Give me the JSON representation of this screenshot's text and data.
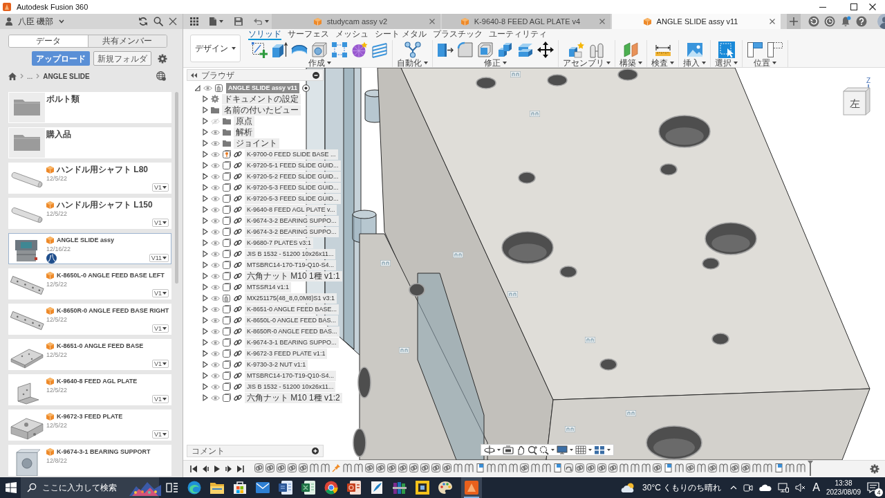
{
  "window": {
    "title": "Autodesk Fusion 360"
  },
  "data_panel": {
    "user": "八臣 磯部",
    "tabs": [
      {
        "label": "データ",
        "selected": true
      },
      {
        "label": "共有メンバー",
        "selected": false
      }
    ],
    "upload_button": "アップロード",
    "new_folder_button": "新規フォルダ",
    "breadcrumb": [
      "...",
      "ANGLE SLIDE"
    ],
    "items": [
      {
        "kind": "folder",
        "title": "ボルト類"
      },
      {
        "kind": "folder",
        "title": "購入品"
      },
      {
        "kind": "shaft",
        "title": "ハンドル用シャフト L80",
        "date": "12/5/22",
        "version": "V1",
        "selected": false
      },
      {
        "kind": "shaft",
        "title": "ハンドル用シャフト L150",
        "date": "12/5/22",
        "version": "V1",
        "selected": false
      },
      {
        "kind": "assembly",
        "title": "ANGLE SLIDE assy",
        "date": "12/16/22",
        "version": "V11",
        "selected": true,
        "editor": "八"
      },
      {
        "kind": "rail",
        "title": "K-8650L-0 ANGLE FEED BASE LEFT",
        "date": "12/5/22",
        "version": "V1",
        "selected": false
      },
      {
        "kind": "rail",
        "title": "K-8650R-0 ANGLE FEED BASE RIGHT",
        "date": "12/5/22",
        "version": "V1",
        "selected": false
      },
      {
        "kind": "plate",
        "title": "K-8651-0 ANGLE FEED BASE",
        "date": "12/5/22",
        "version": "V1",
        "selected": false
      },
      {
        "kind": "bracket",
        "title": "K-9640-8 FEED AGL PLATE",
        "date": "12/5/22",
        "version": "V1",
        "selected": false
      },
      {
        "kind": "block",
        "title": "K-9672-3 FEED PLATE",
        "date": "12/5/22",
        "version": "V1",
        "selected": false
      },
      {
        "kind": "support",
        "title": "K-9674-3-1 BEARING SUPPORT",
        "date": "12/8/22",
        "selected": false
      }
    ]
  },
  "document_tabs": [
    {
      "label": "studycam assy v2",
      "selected": false
    },
    {
      "label": "K-9640-8 FEED AGL PLATE v4",
      "selected": false
    },
    {
      "label": "ANGLE SLIDE assy v11",
      "selected": true
    }
  ],
  "toolbar": {
    "workspace": "デザイン",
    "tabs": [
      {
        "label": "ソリッド",
        "selected": true
      },
      {
        "label": "サーフェス",
        "selected": false
      },
      {
        "label": "メッシュ",
        "selected": false
      },
      {
        "label": "シート メタル",
        "selected": false
      },
      {
        "label": "プラスチック",
        "selected": false
      },
      {
        "label": "ユーティリティ",
        "selected": false
      }
    ],
    "groups": [
      {
        "label": "作成"
      },
      {
        "label": "自動化"
      },
      {
        "label": "修正"
      },
      {
        "label": "アセンブリ"
      },
      {
        "label": "構築"
      },
      {
        "label": "検査"
      },
      {
        "label": "挿入"
      },
      {
        "label": "選択"
      },
      {
        "label": "位置"
      }
    ]
  },
  "browser": {
    "title": "ブラウザ",
    "root": {
      "label": "ANGLE SLIDE assy v11",
      "expanded": true,
      "visible": true
    },
    "nodes": [
      {
        "kind": "settings",
        "label": "ドキュメントの設定",
        "expanded": false
      },
      {
        "kind": "views",
        "label": "名前の付いたビュー",
        "expanded": false
      },
      {
        "kind": "folder",
        "label": "原点",
        "expanded": false,
        "visible": false
      },
      {
        "kind": "folder",
        "label": "解析",
        "expanded": false,
        "visible": true
      },
      {
        "kind": "folder",
        "label": "ジョイント",
        "expanded": false,
        "visible": true
      },
      {
        "kind": "component",
        "label": "K-9700-0 FEED SLIDE BASE ...",
        "expanded": false,
        "visible": true,
        "grounded": true
      },
      {
        "kind": "component",
        "label": "K-9720-5-1 FEED SLIDE GUID...",
        "expanded": false,
        "visible": true,
        "grounded": false
      },
      {
        "kind": "component",
        "label": "K-9720-5-2 FEED SLIDE GUID...",
        "expanded": false,
        "visible": true,
        "grounded": false
      },
      {
        "kind": "component",
        "label": "K-9720-5-3 FEED SLIDE GUID...",
        "expanded": false,
        "visible": true,
        "grounded": false
      },
      {
        "kind": "component",
        "label": "K-9720-5-3 FEED SLIDE GUID...",
        "expanded": false,
        "visible": true,
        "grounded": false
      },
      {
        "kind": "component",
        "label": "K-9640-8 FEED AGL PLATE v...",
        "expanded": false,
        "visible": true,
        "grounded": false
      },
      {
        "kind": "component",
        "label": "K-9674-3-2 BEARING SUPPO...",
        "expanded": false,
        "visible": true,
        "grounded": false
      },
      {
        "kind": "component",
        "label": "K-9674-3-2 BEARING SUPPO...",
        "expanded": false,
        "visible": true,
        "grounded": false
      },
      {
        "kind": "component",
        "label": "K-9680-7 PLATES v3:1",
        "expanded": false,
        "visible": true,
        "grounded": false
      },
      {
        "kind": "component",
        "label": "JIS B 1532 - 51200 10x26x11...",
        "expanded": false,
        "visible": true,
        "grounded": false
      },
      {
        "kind": "component",
        "label": "MTSBRC14-170-T19-Q10-S4...",
        "expanded": false,
        "visible": true,
        "grounded": false
      },
      {
        "kind": "component",
        "label": "六角ナット M10 1種 v1:1",
        "expanded": false,
        "visible": true,
        "grounded": false
      },
      {
        "kind": "component",
        "label": "MTSSR14 v1:1",
        "expanded": false,
        "visible": true,
        "grounded": false
      },
      {
        "kind": "assembly",
        "label": "MX251175(48_8,0,0M8)S1 v3:1",
        "expanded": false,
        "visible": true,
        "grounded": false
      },
      {
        "kind": "component",
        "label": "K-8651-0 ANGLE FEED BASE...",
        "expanded": false,
        "visible": true,
        "grounded": false
      },
      {
        "kind": "component",
        "label": "K-8650L-0 ANGLE FEED BAS...",
        "expanded": false,
        "visible": true,
        "grounded": false
      },
      {
        "kind": "component",
        "label": "K-8650R-0 ANGLE FEED BAS...",
        "expanded": false,
        "visible": true,
        "grounded": false
      },
      {
        "kind": "component",
        "label": "K-9674-3-1 BEARING SUPPO...",
        "expanded": false,
        "visible": true,
        "grounded": false
      },
      {
        "kind": "component",
        "label": "K-9672-3 FEED PLATE v1:1",
        "expanded": false,
        "visible": true,
        "grounded": false
      },
      {
        "kind": "component",
        "label": "K-9730-3-2 NUT v1:1",
        "expanded": false,
        "visible": true,
        "grounded": false
      },
      {
        "kind": "component",
        "label": "MTSBRC14-170-T19-Q10-S4...",
        "expanded": false,
        "visible": true,
        "grounded": false
      },
      {
        "kind": "component",
        "label": "JIS B 1532 - 51200 10x26x11...",
        "expanded": false,
        "visible": true,
        "grounded": false
      },
      {
        "kind": "component",
        "label": "六角ナット M10 1種 v1:2",
        "expanded": false,
        "visible": true,
        "grounded": false
      }
    ]
  },
  "comments": {
    "title": "コメント"
  },
  "viewcube": {
    "face": "左",
    "axis": "Z"
  },
  "taskbar": {
    "search_placeholder": "ここに入力して検索",
    "weather": "30°C くもりのち晴れ",
    "ime": "A",
    "time": "13:38",
    "date": "2023/08/09",
    "notifications": "4"
  }
}
